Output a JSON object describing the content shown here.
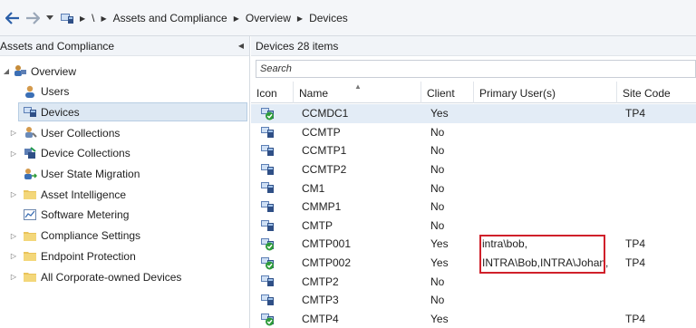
{
  "breadcrumb": {
    "items": [
      "\\",
      "Assets and Compliance",
      "Overview",
      "Devices"
    ]
  },
  "left_pane": {
    "title": "Assets and Compliance",
    "tree": [
      {
        "label": "Overview",
        "icon": "overview-icon",
        "level": 0,
        "expanded": true
      },
      {
        "label": "Users",
        "icon": "user-icon",
        "level": 1
      },
      {
        "label": "Devices",
        "icon": "devices-icon",
        "level": 1,
        "selected": true
      },
      {
        "label": "User Collections",
        "icon": "user-collections-icon",
        "level": 1,
        "expandable": true
      },
      {
        "label": "Device Collections",
        "icon": "device-collections-icon",
        "level": 1,
        "expandable": true
      },
      {
        "label": "User State Migration",
        "icon": "user-state-migration-icon",
        "level": 1
      },
      {
        "label": "Asset Intelligence",
        "icon": "folder-icon",
        "level": 1,
        "expandable": true
      },
      {
        "label": "Software Metering",
        "icon": "software-metering-icon",
        "level": 1
      },
      {
        "label": "Compliance Settings",
        "icon": "folder-icon",
        "level": 1,
        "expandable": true
      },
      {
        "label": "Endpoint Protection",
        "icon": "folder-icon",
        "level": 1,
        "expandable": true
      },
      {
        "label": "All Corporate-owned Devices",
        "icon": "folder-icon",
        "level": 1,
        "expandable": true
      }
    ]
  },
  "list": {
    "header": "Devices 28 items",
    "search_placeholder": "Search",
    "columns": [
      "Icon",
      "Name",
      "Client",
      "Primary User(s)",
      "Site Code"
    ],
    "rows": [
      {
        "name": "CCMDC1",
        "client": "Yes",
        "primary_users": "",
        "site_code": "TP4",
        "managed": true,
        "selected": true
      },
      {
        "name": "CCMTP",
        "client": "No",
        "primary_users": "",
        "site_code": "",
        "managed": false
      },
      {
        "name": "CCMTP1",
        "client": "No",
        "primary_users": "",
        "site_code": "",
        "managed": false
      },
      {
        "name": "CCMTP2",
        "client": "No",
        "primary_users": "",
        "site_code": "",
        "managed": false
      },
      {
        "name": "CM1",
        "client": "No",
        "primary_users": "",
        "site_code": "",
        "managed": false
      },
      {
        "name": "CMMP1",
        "client": "No",
        "primary_users": "",
        "site_code": "",
        "managed": false
      },
      {
        "name": "CMTP",
        "client": "No",
        "primary_users": "",
        "site_code": "",
        "managed": false
      },
      {
        "name": "CMTP001",
        "client": "Yes",
        "primary_users": "intra\\bob,",
        "site_code": "TP4",
        "managed": true
      },
      {
        "name": "CMTP002",
        "client": "Yes",
        "primary_users": "INTRA\\Bob,INTRA\\Johan,",
        "site_code": "TP4",
        "managed": true
      },
      {
        "name": "CMTP2",
        "client": "No",
        "primary_users": "",
        "site_code": "",
        "managed": false
      },
      {
        "name": "CMTP3",
        "client": "No",
        "primary_users": "",
        "site_code": "",
        "managed": false
      },
      {
        "name": "CMTP4",
        "client": "Yes",
        "primary_users": "",
        "site_code": "TP4",
        "managed": true
      }
    ]
  },
  "colors": {
    "highlight": "#d0202a",
    "selection": "#dde8f3",
    "managed_check": "#2e9b3a"
  }
}
